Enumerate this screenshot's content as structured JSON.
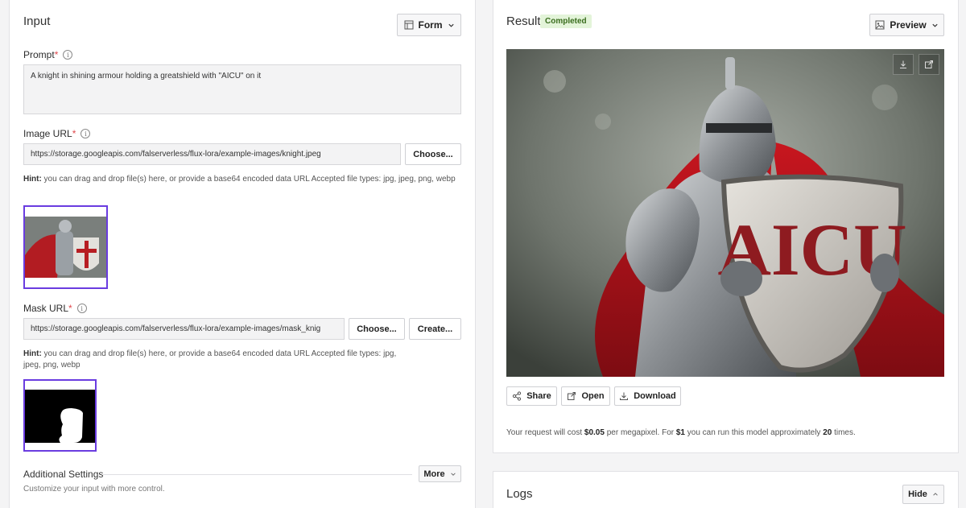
{
  "input": {
    "title": "Input",
    "form_button": "Form",
    "prompt": {
      "label": "Prompt",
      "required_mark": "*",
      "value": "A knight in shining armour holding a greatshield with \"AICU\" on it"
    },
    "image_url": {
      "label": "Image URL",
      "required_mark": "*",
      "value": "https://storage.googleapis.com/falserverless/flux-lora/example-images/knight.jpeg",
      "choose_button": "Choose..."
    },
    "image_hint": {
      "bold": "Hint:",
      "text": " you can drag and drop file(s) here, or provide a base64 encoded data URL Accepted file types: jpg, jpeg, png, webp"
    },
    "mask_url": {
      "label": "Mask URL",
      "required_mark": "*",
      "value": "https://storage.googleapis.com/falserverless/flux-lora/example-images/mask_knig",
      "choose_button": "Choose...",
      "create_button": "Create..."
    },
    "mask_hint": {
      "bold": "Hint:",
      "text": " you can drag and drop file(s) here, or provide a base64 encoded data URL Accepted file types: jpg, jpeg, png, webp"
    },
    "additional_settings": {
      "title": "Additional Settings",
      "subtitle": "Customize your input with more control.",
      "more_button": "More"
    }
  },
  "result": {
    "title": "Result",
    "status": "Completed",
    "preview_button": "Preview",
    "actions": {
      "share": "Share",
      "open": "Open",
      "download": "Download"
    },
    "image_text": "AICU",
    "cost": {
      "p1": "Your request will cost ",
      "price": "$0.05",
      "p2": " per megapixel. For ",
      "budget": "$1",
      "p3": " you can run this model approximately ",
      "count": "20",
      "p4": " times."
    }
  },
  "logs": {
    "title": "Logs",
    "hide_button": "Hide"
  },
  "colors": {
    "accent_purple": "#6a3ce0",
    "completed_bg": "#e3f4d9",
    "completed_text": "#3a6d1e",
    "required_red": "#e0484d"
  }
}
